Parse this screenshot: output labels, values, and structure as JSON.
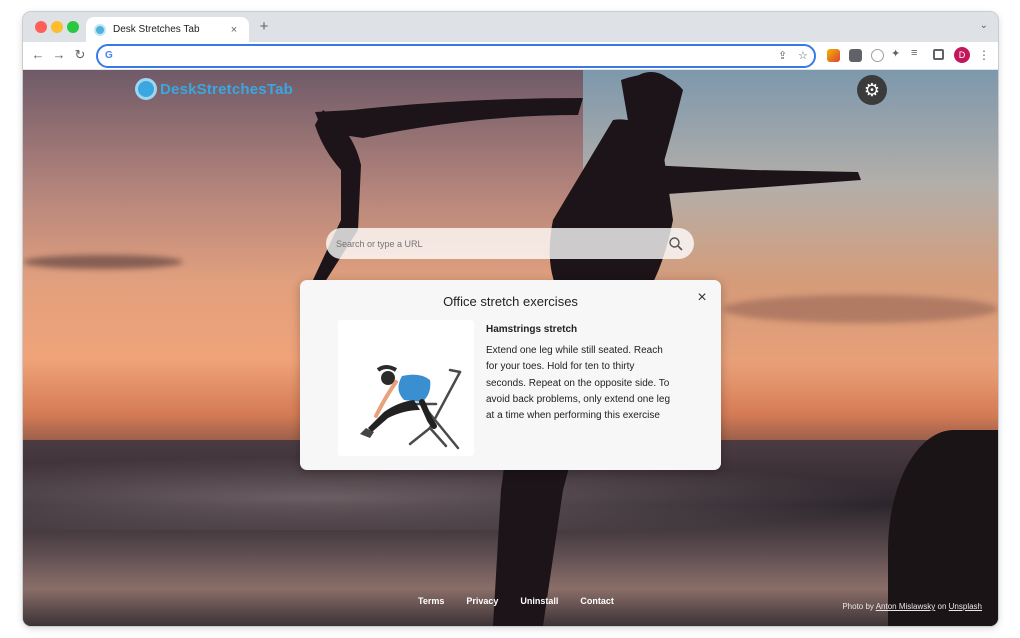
{
  "browser": {
    "tab_title": "Desk Stretches Tab",
    "tab_close": "×",
    "new_tab": "+",
    "tab_menu": "⌄",
    "back": "←",
    "forward": "→",
    "reload": "↻",
    "omnibox_value": "",
    "profile_initial": "D"
  },
  "page": {
    "brand_name": "DeskStretchesTab",
    "search_placeholder": "Search or type a URL",
    "card": {
      "title": "Office stretch exercises",
      "close": "×",
      "exercise_name": "Hamstrings stretch",
      "exercise_description": "Extend one leg while still seated. Reach for your toes. Hold for ten to thirty seconds. Repeat on the opposite side. To avoid back problems, only extend one leg at a time when performing this exercise"
    },
    "footer_links": [
      "Terms",
      "Privacy",
      "Uninstall",
      "Contact"
    ],
    "credit": {
      "prefix": "Photo by",
      "author": "Anton Mislawsky",
      "on": "on",
      "source": "Unsplash"
    }
  },
  "colors": {
    "brand": "#3aa7e0",
    "omnibox_focus": "#3b78e7",
    "profile": "#c2185b"
  }
}
